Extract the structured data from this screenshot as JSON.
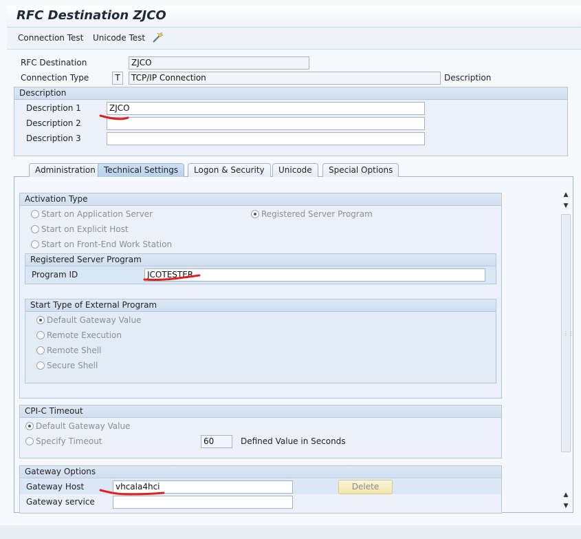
{
  "title": "RFC Destination ZJCO",
  "toolbar": {
    "connection_test": "Connection Test",
    "unicode_test": "Unicode Test",
    "icon": "wand-icon"
  },
  "header": {
    "rfc_destination_label": "RFC Destination",
    "rfc_destination_value": "ZJCO",
    "connection_type_label": "Connection Type",
    "connection_type_code": "T",
    "connection_type_value": "TCP/IP Connection",
    "description_label": "Description"
  },
  "description_group": {
    "title": "Description",
    "desc1_label": "Description 1",
    "desc1_value": "ZJCO",
    "desc2_label": "Description 2",
    "desc2_value": "",
    "desc3_label": "Description 3",
    "desc3_value": ""
  },
  "tabs": [
    "Administration",
    "Technical Settings",
    "Logon & Security",
    "Unicode",
    "Special Options"
  ],
  "active_tab": "Technical Settings",
  "activation_type": {
    "title": "Activation Type",
    "start_app_server": "Start on Application Server",
    "registered_server_program": "Registered Server Program",
    "start_explicit_host": "Start on Explicit Host",
    "start_frontend": "Start on Front-End Work Station",
    "selected": "Registered Server Program"
  },
  "registered_server": {
    "title": "Registered Server Program",
    "program_id_label": "Program ID",
    "program_id_value": "JCOTESTER"
  },
  "start_type": {
    "title": "Start Type of External Program",
    "default_gateway": "Default Gateway Value",
    "remote_execution": "Remote Execution",
    "remote_shell": "Remote Shell",
    "secure_shell": "Secure Shell",
    "selected": "Default Gateway Value"
  },
  "cpic": {
    "title": "CPI-C Timeout",
    "default_gateway": "Default Gateway Value",
    "specify_timeout": "Specify Timeout",
    "timeout_value": "60",
    "defined_value_label": "Defined Value in Seconds",
    "selected": "Default Gateway Value"
  },
  "gateway": {
    "title": "Gateway Options",
    "host_label": "Gateway Host",
    "host_value": "vhcala4hci",
    "service_label": "Gateway service",
    "service_value": "",
    "delete_button": "Delete"
  },
  "annotation_color": "#e02020"
}
